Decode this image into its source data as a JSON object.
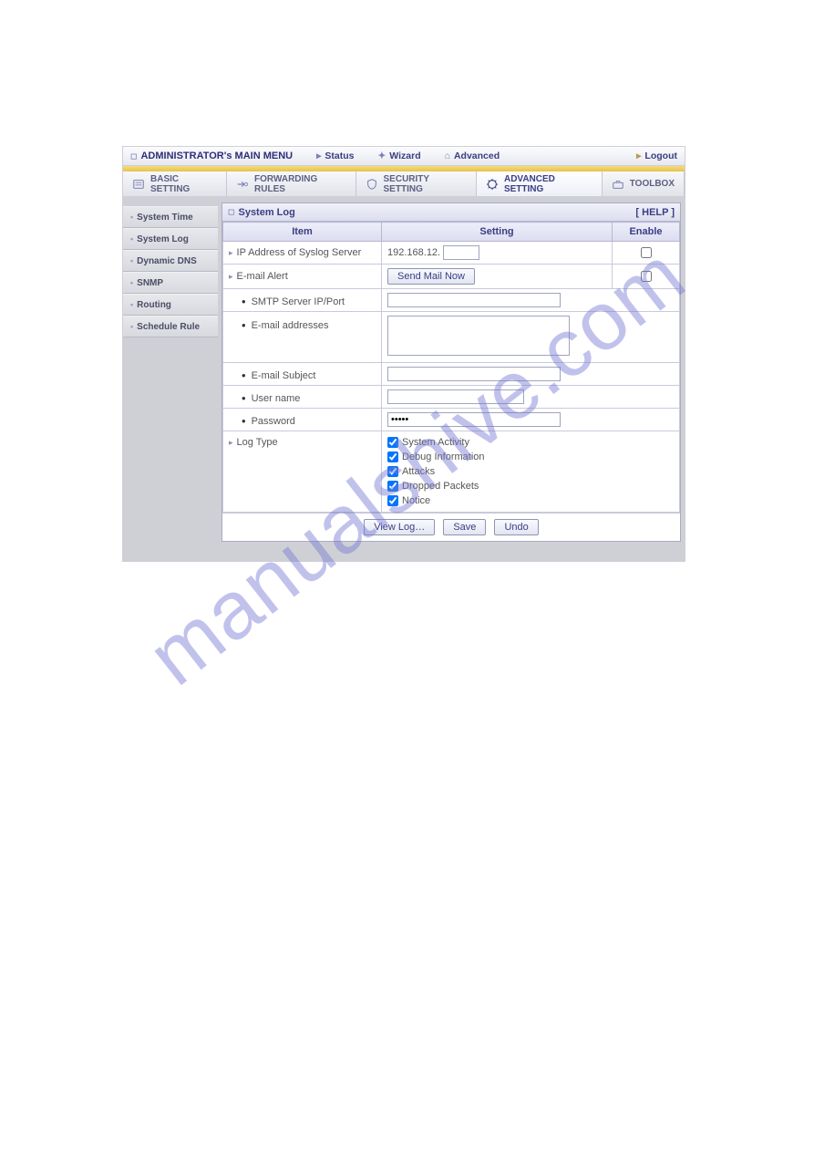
{
  "topbar": {
    "title": "ADMINISTRATOR's MAIN MENU",
    "status": "Status",
    "wizard": "Wizard",
    "advanced": "Advanced",
    "logout": "Logout"
  },
  "tabs": {
    "basic": "BASIC SETTING",
    "forwarding": "FORWARDING RULES",
    "security": "SECURITY SETTING",
    "advanced": "ADVANCED SETTING",
    "toolbox": "TOOLBOX"
  },
  "sidebar": {
    "items": [
      {
        "label": "System Time"
      },
      {
        "label": "System Log"
      },
      {
        "label": "Dynamic DNS"
      },
      {
        "label": "SNMP"
      },
      {
        "label": "Routing"
      },
      {
        "label": "Schedule Rule"
      }
    ]
  },
  "panel": {
    "title": "System Log",
    "help": "[ HELP ]",
    "columns": {
      "item": "Item",
      "setting": "Setting",
      "enable": "Enable"
    },
    "rows": {
      "syslog": {
        "label": "IP Address of Syslog Server",
        "value": "192.168.12."
      },
      "emailAlert": {
        "label": "E-mail Alert",
        "button": "Send Mail Now"
      },
      "smtp": {
        "label": "SMTP Server IP/Port",
        "value": ""
      },
      "addresses": {
        "label": "E-mail addresses",
        "value": ""
      },
      "subject": {
        "label": "E-mail Subject",
        "value": ""
      },
      "username": {
        "label": "User name",
        "value": ""
      },
      "password": {
        "label": "Password",
        "value": "•••••"
      },
      "logtype": {
        "label": "Log Type",
        "options": [
          {
            "label": "System Activity",
            "checked": true
          },
          {
            "label": "Debug Information",
            "checked": true
          },
          {
            "label": "Attacks",
            "checked": true
          },
          {
            "label": "Dropped Packets",
            "checked": true
          },
          {
            "label": "Notice",
            "checked": true
          }
        ]
      }
    },
    "buttons": {
      "viewlog": "View Log…",
      "save": "Save",
      "undo": "Undo"
    }
  },
  "watermark": "manualshive.com"
}
